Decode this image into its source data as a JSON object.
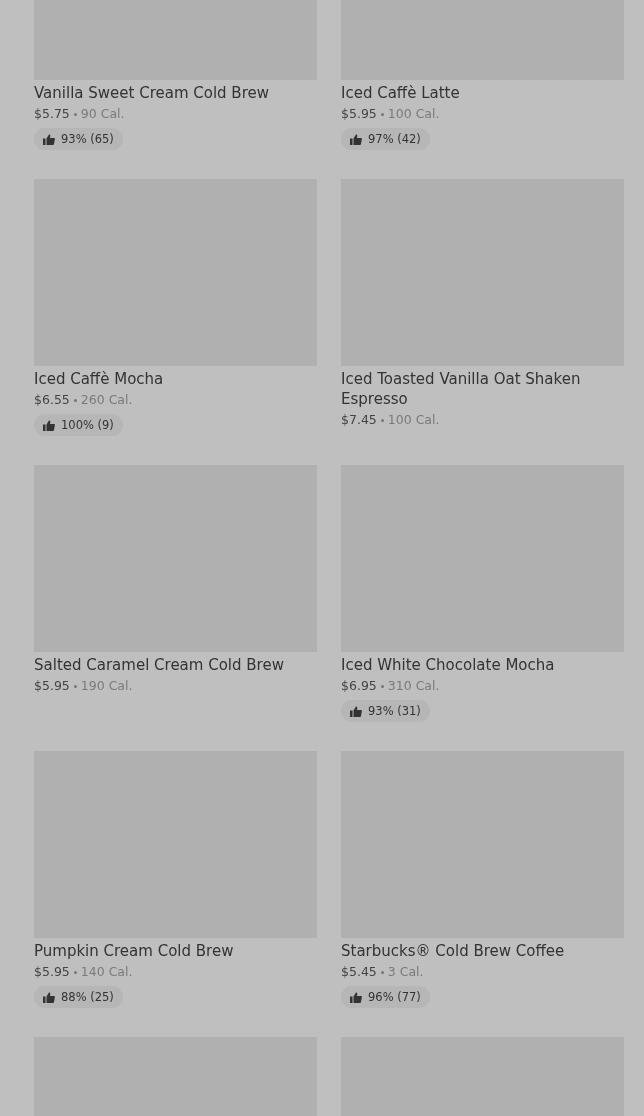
{
  "products": [
    {
      "kind": "product",
      "name": "Vanilla Sweet Cream Cold Brew",
      "price": "$5.75",
      "calories": "90 Cal.",
      "rating": "93% (65)"
    },
    {
      "kind": "product",
      "name": "Iced Caffè Latte",
      "price": "$5.95",
      "calories": "100 Cal.",
      "rating": "97% (42)"
    },
    {
      "kind": "product",
      "name": "Iced Caffè Mocha",
      "price": "$6.55",
      "calories": "260 Cal.",
      "rating": "100% (9)"
    },
    {
      "kind": "product",
      "name": "Iced Toasted Vanilla Oat Shaken Espresso",
      "price": "$7.45",
      "calories": "100 Cal."
    },
    {
      "kind": "product",
      "name": "Salted Caramel Cream Cold Brew",
      "price": "$5.95",
      "calories": "190 Cal."
    },
    {
      "kind": "product",
      "name": "Iced White Chocolate Mocha",
      "price": "$6.95",
      "calories": "310 Cal.",
      "rating": "93% (31)"
    },
    {
      "kind": "product",
      "name": "Pumpkin Cream Cold Brew",
      "price": "$5.95",
      "calories": "140 Cal.",
      "rating": "88% (25)"
    },
    {
      "kind": "product",
      "name": "Starbucks® Cold Brew Coffee",
      "price": "$5.45",
      "calories": "3 Cal.",
      "rating": "96% (77)"
    },
    {
      "kind": "image-only"
    },
    {
      "kind": "image-only"
    }
  ]
}
